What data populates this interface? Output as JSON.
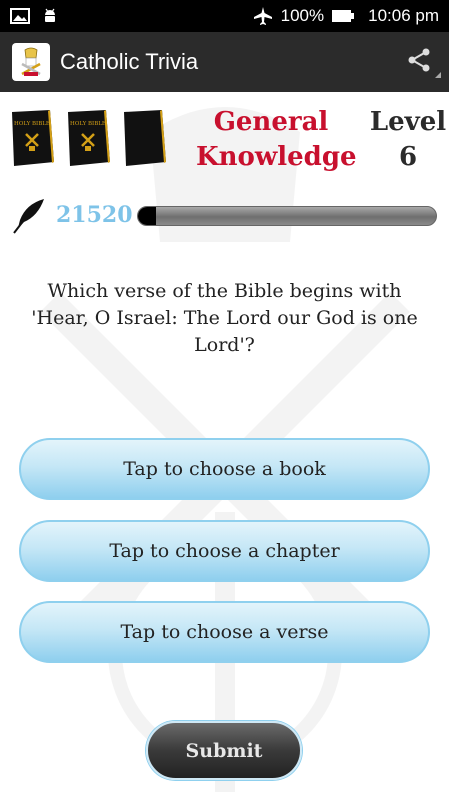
{
  "status_bar": {
    "battery": "100%",
    "time": "10:06 pm",
    "icons": [
      "image-icon",
      "android-icon",
      "airplane-icon",
      "battery-icon"
    ]
  },
  "app_bar": {
    "title": "Catholic Trivia",
    "logo_icon": "papal-seal-icon",
    "share_icon": "share-icon"
  },
  "header": {
    "book_icons": [
      "holy-bible-icon",
      "holy-bible-icon",
      "blank-book-icon"
    ],
    "book_label": "HOLY BIBLE",
    "category_line1": "General",
    "category_line2": "Knowledge",
    "level_label": "Level",
    "level_value": "6"
  },
  "score": {
    "value": "21520",
    "progress_fraction": 0.06,
    "icon": "quill-icon"
  },
  "question": {
    "text": "Which verse of the Bible begins with 'Hear, O Israel: The Lord our God is one Lord'?"
  },
  "choices": {
    "book": "Tap to choose a book",
    "chapter": "Tap to choose a chapter",
    "verse": "Tap to choose a verse"
  },
  "submit_label": "Submit",
  "colors": {
    "category": "#c8102e",
    "score": "#7ec3e8",
    "button_border": "#8fd0ee",
    "app_bar": "#2b2b2b"
  }
}
